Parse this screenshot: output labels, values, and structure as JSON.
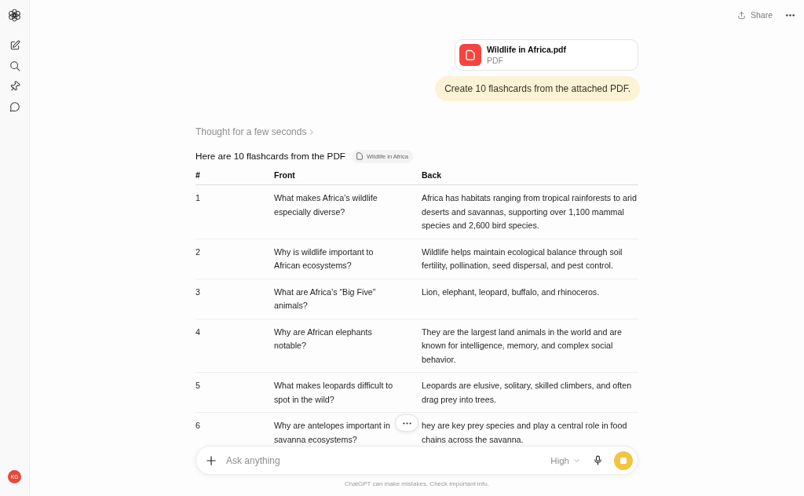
{
  "sidebar": {
    "avatar_initials": "KG"
  },
  "header": {
    "share_label": "Share"
  },
  "attachment": {
    "file_name": "Wildlife in Africa.pdf",
    "file_type": "PDF"
  },
  "user_message": "Create 10 flashcards from the attached PDF.",
  "thought_label": "Thought for a few seconds",
  "response": {
    "intro": "Here are 10 flashcards from the PDF",
    "source_chip": "Wildlife in Africa",
    "table": {
      "columns": [
        "#",
        "Front",
        "Back"
      ],
      "rows": [
        [
          "1",
          "What makes Africa’s wildlife especially diverse?",
          "Africa has habitats ranging from tropical rainforests to arid deserts and savannas, supporting over 1,100 mammal species and 2,600 bird species."
        ],
        [
          "2",
          "Why is wildlife important to African ecosystems?",
          "Wildlife helps maintain ecological balance through soil fertility, pollination, seed dispersal, and pest control."
        ],
        [
          "3",
          "What are Africa’s “Big Five” animals?",
          "Lion, elephant, leopard, buffalo, and rhinoceros."
        ],
        [
          "4",
          "Why are African elephants notable?",
          "They are the largest land animals in the world and are known for intelligence, memory, and complex social behavior."
        ],
        [
          "5",
          "What makes leopards difficult to spot in the wild?",
          "Leopards are elusive, solitary, skilled climbers, and often drag prey into trees."
        ],
        [
          "6",
          "Why are antelopes important in savanna ecosystems?",
          "hey are key prey species and play a central role in food chains across the savanna."
        ]
      ]
    }
  },
  "composer": {
    "placeholder": "Ask anything",
    "mode": "High"
  },
  "disclaimer": "ChatGPT can make mistakes. Check important info."
}
